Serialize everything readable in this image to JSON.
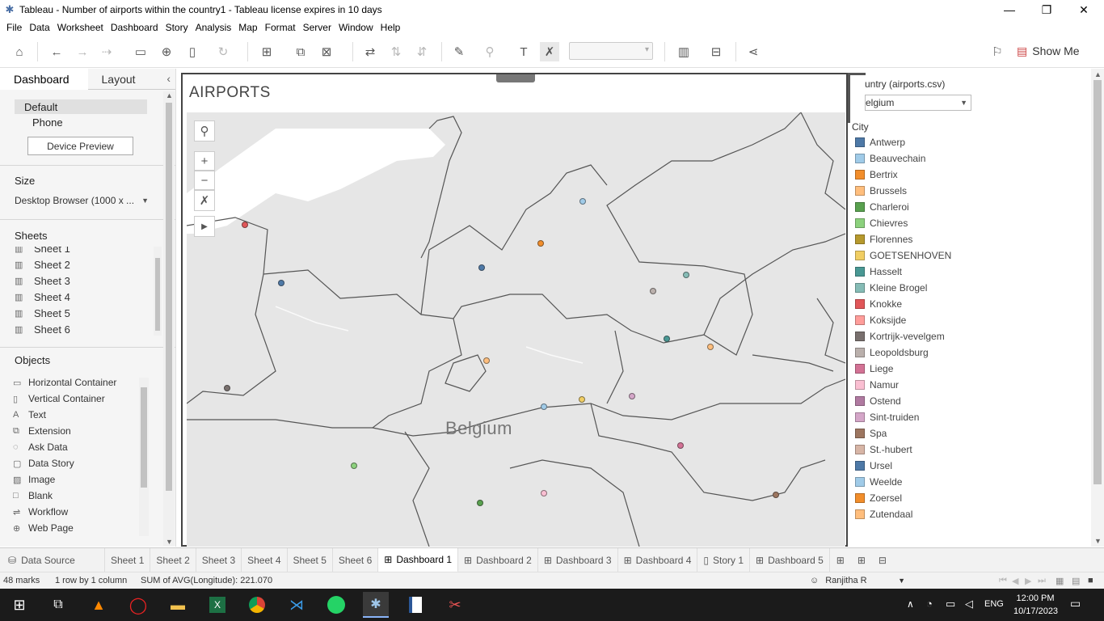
{
  "window": {
    "title": "Tableau - Number of airports within the country1 - Tableau license expires in 10 days"
  },
  "menu": [
    "File",
    "Data",
    "Worksheet",
    "Dashboard",
    "Story",
    "Analysis",
    "Map",
    "Format",
    "Server",
    "Window",
    "Help"
  ],
  "toolbar": {
    "show_me": "Show Me"
  },
  "left_panel": {
    "tab_dashboard": "Dashboard",
    "tab_layout": "Layout",
    "devices": [
      "Default",
      "Phone"
    ],
    "device_preview": "Device Preview",
    "size_header": "Size",
    "size_value": "Desktop Browser (1000 x ...",
    "sheets_header": "Sheets",
    "sheets": [
      "Sheet 1",
      "Sheet 2",
      "Sheet 3",
      "Sheet 4",
      "Sheet 5",
      "Sheet 6"
    ],
    "objects_header": "Objects",
    "objects": [
      {
        "label": "Horizontal Container",
        "icon": "horizontal-container-icon"
      },
      {
        "label": "Vertical Container",
        "icon": "vertical-container-icon"
      },
      {
        "label": "Text",
        "icon": "text-icon"
      },
      {
        "label": "Extension",
        "icon": "extension-icon"
      },
      {
        "label": "Ask Data",
        "icon": "ask-data-icon"
      },
      {
        "label": "Data Story",
        "icon": "data-story-icon"
      },
      {
        "label": "Image",
        "icon": "image-icon"
      },
      {
        "label": "Blank",
        "icon": "blank-icon"
      },
      {
        "label": "Workflow",
        "icon": "workflow-icon"
      },
      {
        "label": "Web Page",
        "icon": "web-page-icon"
      }
    ]
  },
  "dashboard": {
    "title": "AIRPORTS",
    "map_label": "Belgium"
  },
  "filter": {
    "header": "Country (airports.csv)",
    "header_visible": "untry (airports.csv)",
    "value": "Belgium",
    "value_visible": "elgium"
  },
  "legend": {
    "header": "City",
    "items": [
      {
        "label": "Antwerp",
        "color": "#4e79a7"
      },
      {
        "label": "Beauvechain",
        "color": "#a0cbe8"
      },
      {
        "label": "Bertrix",
        "color": "#f28e2b"
      },
      {
        "label": "Brussels",
        "color": "#ffbe7d"
      },
      {
        "label": "Charleroi",
        "color": "#59a14f"
      },
      {
        "label": "Chievres",
        "color": "#8cd17d"
      },
      {
        "label": "Florennes",
        "color": "#b6992d"
      },
      {
        "label": "GOETSENHOVEN",
        "color": "#f1ce63"
      },
      {
        "label": "Hasselt",
        "color": "#499894"
      },
      {
        "label": "Kleine Brogel",
        "color": "#86bcb6"
      },
      {
        "label": "Knokke",
        "color": "#e15759"
      },
      {
        "label": "Koksijde",
        "color": "#ff9d9a"
      },
      {
        "label": "Kortrijk-vevelgem",
        "color": "#79706e"
      },
      {
        "label": "Leopoldsburg",
        "color": "#bab0ac"
      },
      {
        "label": "Liege",
        "color": "#d37295"
      },
      {
        "label": "Namur",
        "color": "#fabfd2"
      },
      {
        "label": "Ostend",
        "color": "#b07aa1"
      },
      {
        "label": "Sint-truiden",
        "color": "#d4a6c8"
      },
      {
        "label": "Spa",
        "color": "#9d7660"
      },
      {
        "label": "St.-hubert",
        "color": "#d7b5a6"
      },
      {
        "label": "Ursel",
        "color": "#4e79a7"
      },
      {
        "label": "Weelde",
        "color": "#a0cbe8"
      },
      {
        "label": "Zoersel",
        "color": "#f28e2b"
      },
      {
        "label": "Zutendaal",
        "color": "#ffbe7d"
      }
    ]
  },
  "sheet_tabs": [
    "Data Source",
    "Sheet 1",
    "Sheet 2",
    "Sheet 3",
    "Sheet 4",
    "Sheet 5",
    "Sheet 6",
    "Dashboard 1",
    "Dashboard 2",
    "Dashboard 3",
    "Dashboard 4",
    "Story 1",
    "Dashboard 5"
  ],
  "active_tab": "Dashboard 1",
  "status": {
    "marks": "48 marks",
    "rows": "1 row by 1 column",
    "sum": "SUM of AVG(Longitude): 221.070",
    "user": "Ranjitha R"
  },
  "taskbar": {
    "lang": "ENG",
    "time": "12:00 PM",
    "date": "10/17/2023"
  }
}
